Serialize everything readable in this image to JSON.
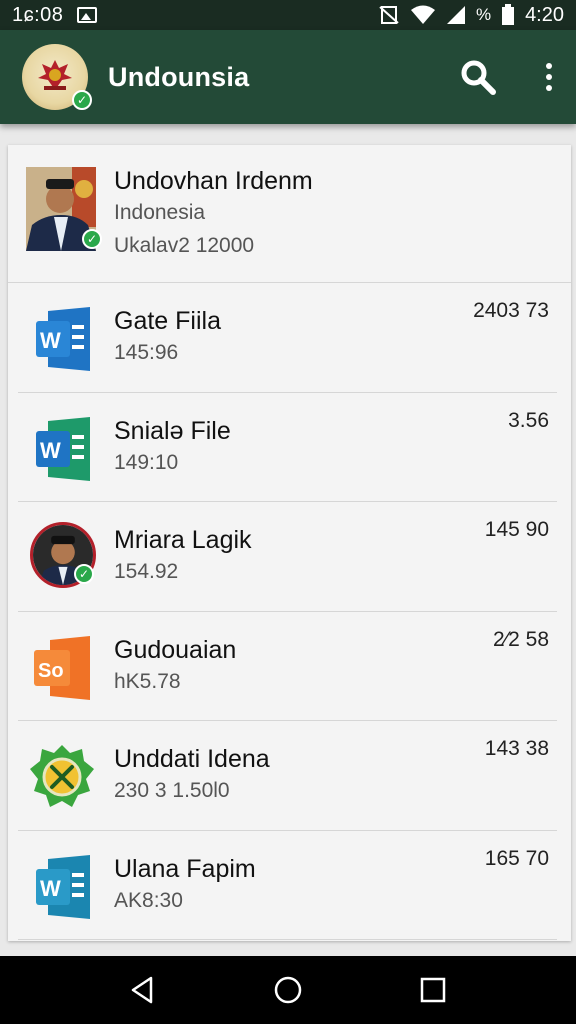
{
  "status_bar": {
    "time_left": "1ɕ:08",
    "clock": "4:20",
    "battery_pct": "%"
  },
  "app_bar": {
    "title": "Undounsia",
    "icons": [
      "search-icon",
      "more-vert-icon"
    ]
  },
  "profile": {
    "name": "Undovhan Irdenm",
    "country": "Indonesia",
    "detail": "Ukalav2 12000"
  },
  "items": [
    {
      "name": "Gate Fiila",
      "sub": "145:96",
      "amount": "2403 73",
      "icon": "word-doc-icon"
    },
    {
      "name": "Snialə File",
      "sub": "149:10",
      "amount": "3.56",
      "icon": "word-doc-icon"
    },
    {
      "name": "Mriara Lagik",
      "sub": "154.92",
      "amount": "145 90",
      "icon": "person-photo"
    },
    {
      "name": "Gudouaian",
      "sub": "hK5.78",
      "amount": "2⁄2 58",
      "icon": "office-app-icon"
    },
    {
      "name": "Unddati Idena",
      "sub": "230 3 1.50l0",
      "amount": "143 38",
      "icon": "green-badge-icon"
    },
    {
      "name": "Ulana Fapim",
      "sub": "AK8:30",
      "amount": "165 70",
      "icon": "word-doc-icon"
    }
  ],
  "colors": {
    "app_bar": "#234a37",
    "status_bar": "#1a2c22",
    "word_blue": "#1f74c4",
    "word_green": "#1e9a6a",
    "office_orange": "#f07226",
    "verified_green": "#2aa84a"
  }
}
